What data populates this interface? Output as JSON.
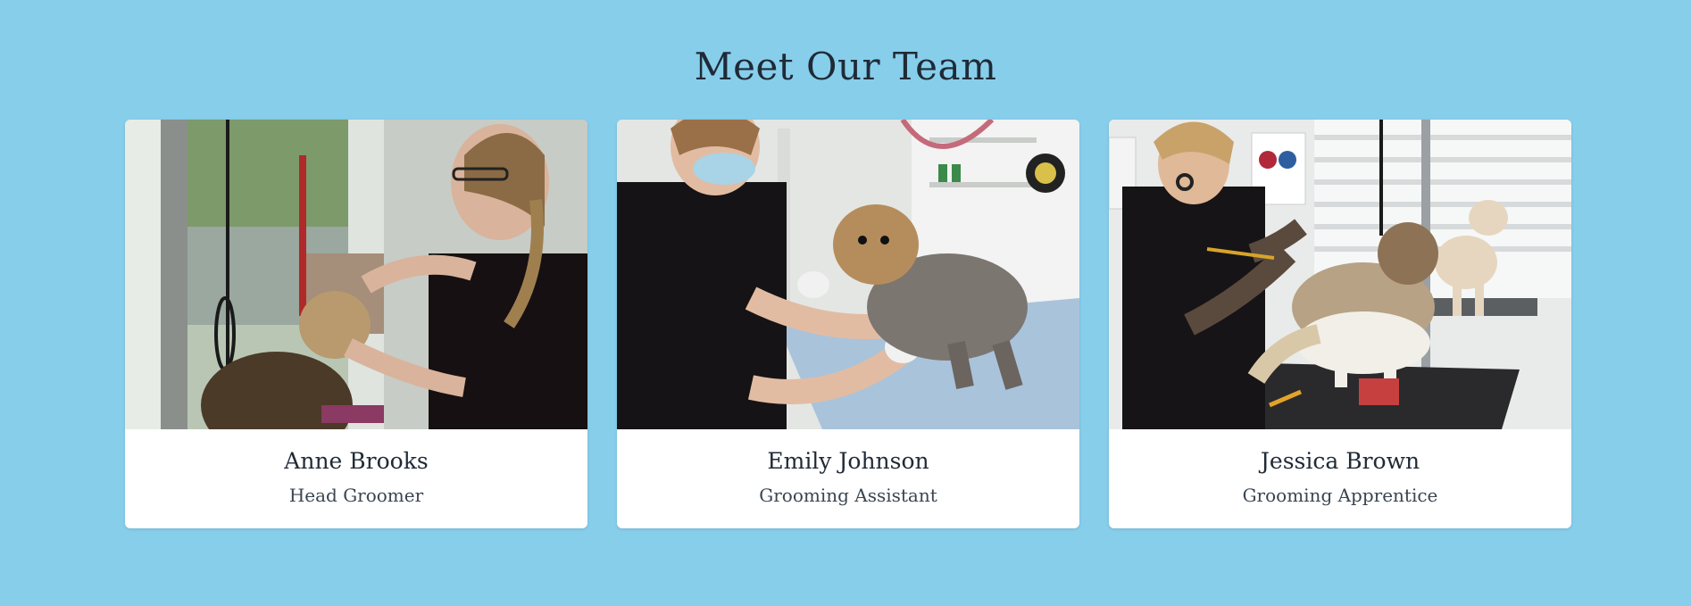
{
  "section": {
    "title": "Meet Our Team"
  },
  "team": [
    {
      "name": "Anne Brooks",
      "role": "Head Groomer",
      "photo_icon": "groomer-trimming-dog-photo"
    },
    {
      "name": "Emily Johnson",
      "role": "Grooming Assistant",
      "photo_icon": "assistant-combing-yorkie-photo"
    },
    {
      "name": "Jessica Brown",
      "role": "Grooming Apprentice",
      "photo_icon": "apprentice-scissoring-shih-tzu-photo"
    }
  ],
  "colors": {
    "background": "#87CEEB",
    "card": "#ffffff",
    "text": "#1f2a36"
  }
}
